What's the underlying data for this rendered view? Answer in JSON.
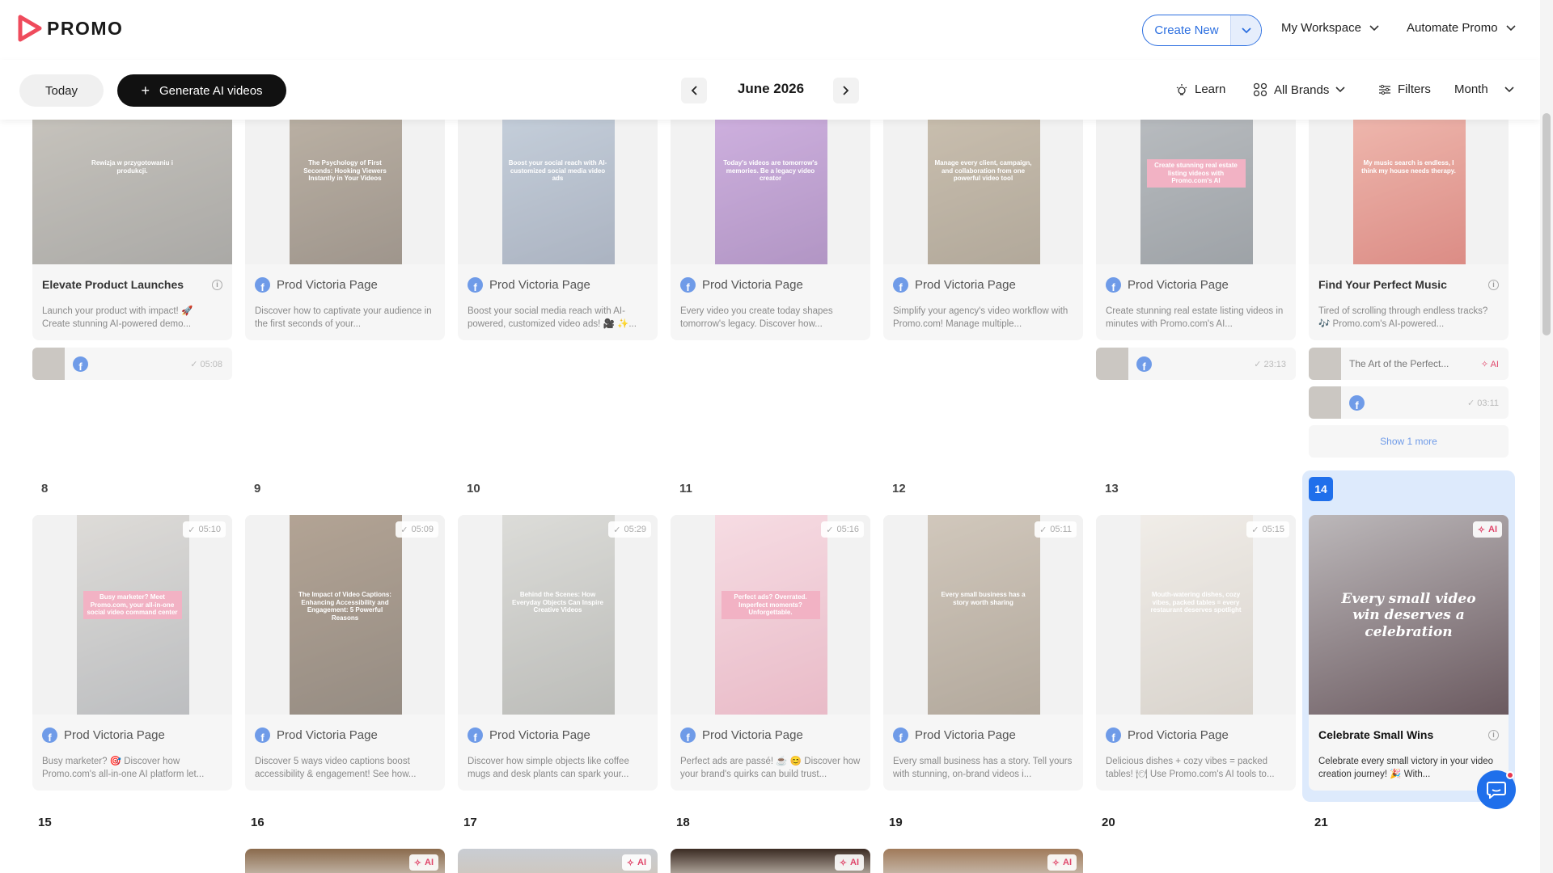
{
  "app": {
    "brand": "PROMO",
    "logo_icon": "promo-play-logo"
  },
  "header": {
    "create_new": "Create New",
    "workspace": "My Workspace",
    "automate": "Automate Promo"
  },
  "toolbar": {
    "today": "Today",
    "generate": "Generate AI videos",
    "month": "June 2026",
    "learn": "Learn",
    "brands": "All Brands",
    "filters": "Filters",
    "view": "Month"
  },
  "colors": {
    "accent": "#1f6feb",
    "ai": "#e0466a",
    "facebook": "#1877f2"
  },
  "week1": {
    "cards": [
      {
        "title": "Elevate Product Launches",
        "desc": "Launch your product with impact! 🚀 Create stunning AI-powered demo...",
        "caption": "Rewizja w przygotowaniu i produkcji.",
        "bold": true
      },
      {
        "title": "Prod Victoria Page",
        "desc": "Discover how to captivate your audience in the first seconds of your...",
        "caption": "The Psychology of First Seconds: Hooking Viewers Instantly in Your Videos"
      },
      {
        "title": "Prod Victoria Page",
        "desc": "Boost your social media reach with AI-powered, customized video ads! 🎥 ✨...",
        "caption": "Boost your social reach with AI-customized social media video ads"
      },
      {
        "title": "Prod Victoria Page",
        "desc": "Every video you create today shapes tomorrow's legacy. Discover how...",
        "caption": "Today's videos are tomorrow's memories. Be a legacy video creator"
      },
      {
        "title": "Prod Victoria Page",
        "desc": "Simplify your agency's video workflow with Promo.com! Manage multiple...",
        "caption": "Manage every client, campaign, and collaboration from one powerful video tool"
      },
      {
        "title": "Prod Victoria Page",
        "desc": "Create stunning real estate listing videos in minutes with Promo.com's AI...",
        "caption": "Create stunning real estate listing videos with Promo.com's AI"
      },
      {
        "title": "Find Your Perfect Music",
        "desc": "Tired of scrolling through endless tracks? 🎶 Promo.com's AI-powered...",
        "caption": "My music search is endless, I think my house needs therapy.",
        "bold": true
      }
    ],
    "mini": {
      "d1": "05:08",
      "d6": "23:13",
      "d7_text": "The Art of the Perfect...",
      "d7_ai": "AI",
      "d7_dur": "03:11",
      "show_more": "Show 1 more"
    }
  },
  "week2": {
    "days": [
      "8",
      "9",
      "10",
      "11",
      "12",
      "13",
      "14"
    ],
    "cards": [
      {
        "title": "Prod Victoria Page",
        "desc": "Busy marketer? 🎯 Discover how Promo.com's all-in-one AI platform let...",
        "badge": "05:10",
        "caption": "Busy marketer? Meet Promo.com, your all-in-one social video command center"
      },
      {
        "title": "Prod Victoria Page",
        "desc": "Discover 5 ways video captions boost accessibility & engagement! See how...",
        "badge": "05:09",
        "caption": "The Impact of Video Captions: Enhancing Accessibility and Engagement: 5 Powerful Reasons"
      },
      {
        "title": "Prod Victoria Page",
        "desc": "Discover how simple objects like coffee mugs and desk plants can spark your...",
        "badge": "05:29",
        "caption": "Behind the Scenes: How Everyday Objects Can Inspire Creative Videos"
      },
      {
        "title": "Prod Victoria Page",
        "desc": "Perfect ads are passé! ☕ 😊 Discover how your brand's quirks can build trust...",
        "badge": "05:16",
        "caption": "Perfect ads? Overrated. Imperfect moments? Unforgettable."
      },
      {
        "title": "Prod Victoria Page",
        "desc": "Every small business has a story. Tell yours with stunning, on-brand videos i...",
        "badge": "05:11",
        "caption": "Every small business has a story worth sharing"
      },
      {
        "title": "Prod Victoria Page",
        "desc": "Delicious dishes + cozy vibes = packed tables! 🍽 Use Promo.com's AI tools to...",
        "badge": "05:15",
        "caption": "Mouth-watering dishes, cozy vibes, packed tables = every restaurant deserves spotlight"
      },
      {
        "title": "Celebrate Small Wins",
        "desc": "Celebrate every small victory in your video creation journey! 🎉 With...",
        "badge": "AI",
        "caption": "Every small video win deserves a celebration",
        "bold": true,
        "active": true
      }
    ]
  },
  "week3": {
    "days": [
      "15",
      "16",
      "17",
      "18",
      "19",
      "20",
      "21"
    ],
    "ai": "AI"
  }
}
